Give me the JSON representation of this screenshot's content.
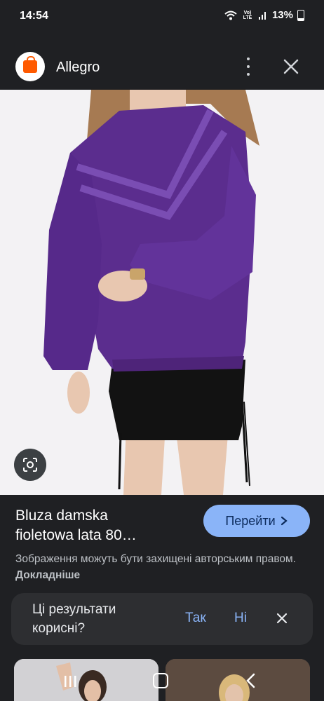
{
  "status_bar": {
    "time": "14:54",
    "network": "Vo) LTE",
    "battery": "13%"
  },
  "header": {
    "site_name": "Allegro",
    "logo_text": "allegro"
  },
  "result": {
    "title_line1": "Bluza damska",
    "title_line2": "fioletowa lata 80…",
    "goto_label": "Перейти",
    "copyright_text": "Зображення можуть бути захищені авторським правом.",
    "learn_more": "Докладніше"
  },
  "feedback": {
    "question": "Ці результати корисні?",
    "yes": "Так",
    "no": "Ні"
  },
  "colors": {
    "background": "#1f2023",
    "accent": "#8ab4f8",
    "brand": "#ff5a00",
    "sweater": "#5b2d8e"
  },
  "icons": [
    "wifi-icon",
    "signal-icon",
    "battery-icon",
    "more-vert-icon",
    "close-icon",
    "google-lens-icon",
    "chevron-right-icon",
    "recent-apps-icon",
    "home-icon",
    "back-icon"
  ]
}
